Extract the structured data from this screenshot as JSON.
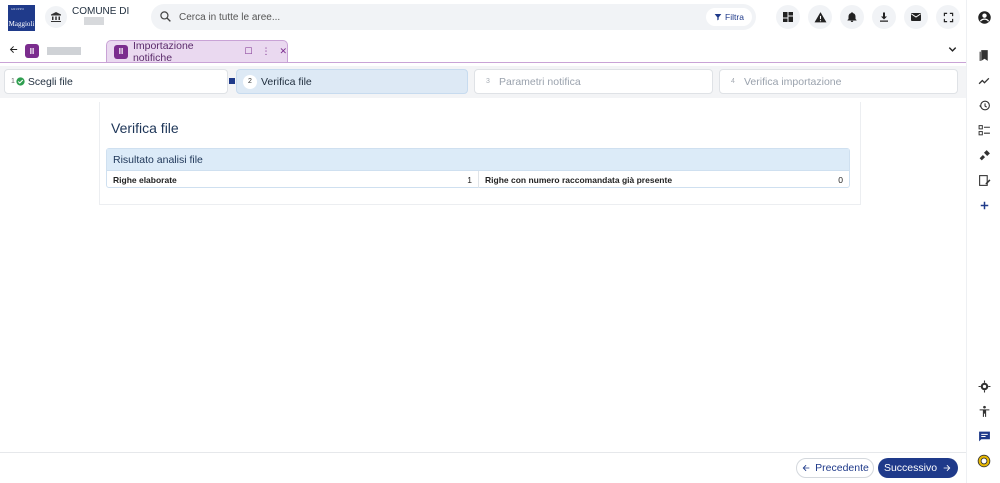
{
  "header": {
    "logo_small": "GRUPPO",
    "logo_text": "Maggioli",
    "comune_label": "COMUNE DI",
    "search_placeholder": "Cerca in tutte le aree...",
    "filter_label": "Filtra"
  },
  "tabs": {
    "active_label": "Importazione notifiche"
  },
  "stepper": {
    "steps": [
      {
        "num": "1",
        "label": "Scegli file",
        "state": "done"
      },
      {
        "num": "2",
        "label": "Verifica file",
        "state": "active"
      },
      {
        "num": "3",
        "label": "Parametri notifica",
        "state": "disabled"
      },
      {
        "num": "4",
        "label": "Verifica importazione",
        "state": "disabled"
      }
    ]
  },
  "main": {
    "title": "Verifica file",
    "section_title": "Risultato analisi file",
    "rows": [
      {
        "label": "Righe elaborate",
        "value": "1"
      },
      {
        "label": "Righe con numero raccomandata già presente",
        "value": "0"
      }
    ]
  },
  "footer": {
    "prev_label": "Precedente",
    "next_label": "Successivo"
  },
  "colors": {
    "primary": "#1f3a8a",
    "tab_accent": "#7b2d8e",
    "step_active_bg": "#dde9f5",
    "success": "#2e9e4f"
  }
}
